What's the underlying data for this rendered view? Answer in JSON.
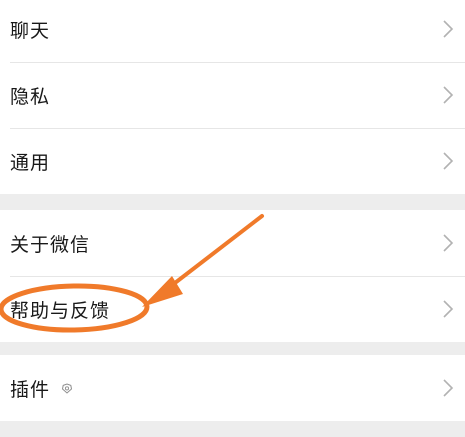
{
  "group1": {
    "items": [
      {
        "label": "聊天",
        "icon": "chevron-right-icon"
      },
      {
        "label": "隐私",
        "icon": "chevron-right-icon"
      },
      {
        "label": "通用",
        "icon": "chevron-right-icon"
      }
    ]
  },
  "group2": {
    "items": [
      {
        "label": "关于微信",
        "icon": "chevron-right-icon"
      },
      {
        "label": "帮助与反馈",
        "icon": "chevron-right-icon"
      }
    ]
  },
  "group3": {
    "items": [
      {
        "label": "插件",
        "badge_icon": "plugin-icon",
        "icon": "chevron-right-icon"
      }
    ]
  },
  "annotation": {
    "color": "#f07a2a",
    "shapes": [
      "arrow-icon",
      "highlight-ellipse"
    ]
  },
  "colors": {
    "background": "#ededed",
    "row_background": "#ffffff",
    "text": "#191919",
    "chevron": "#b2b2b2"
  }
}
